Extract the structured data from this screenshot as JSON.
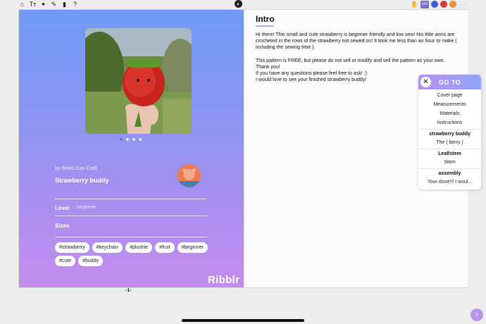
{
  "toolbar": {
    "left_icons": [
      "home-icon",
      "text-size-icon",
      "lightbulb-icon",
      "edit-icon",
      "book-icon",
      "help-icon"
    ],
    "left_glyphs": [
      "⌂",
      "Tт",
      "✦",
      "✎",
      "▮",
      "?"
    ],
    "center_glyph": "◐",
    "right": {
      "hand": "✋",
      "cm": "cm",
      "flags": [
        "#3b5bd9",
        "#d93b3b",
        "#f28c3b"
      ],
      "menu": "⋯"
    }
  },
  "pattern": {
    "author": "by Bears Can Craft",
    "title": "Strawberry buddy",
    "level_label": "Level",
    "level_value": "beginner",
    "sizes_label": "Sizes",
    "tags": [
      "#strawberry",
      "#keychain",
      "#plushie",
      "#fruit",
      "#beginner",
      "#cute",
      "#buddy"
    ],
    "brand": "Ribblr",
    "page_number": "-1-",
    "carousel_dots": 4
  },
  "intro": {
    "title": "Intro",
    "paragraph1": "Hi there! This small and cute strawberry is beginner friendly and low sew! His little arms are crocheted in the rows of the strawberry not sewed on! It took me less than an hour to make ( including the sewing time ).",
    "line2": "This pattern is FREE, but please do not sell or modify and sell the pattern as your own.",
    "line3": "Thank you!",
    "line4": "If you have any questions please feel free to ask! :)",
    "line5": "I would love to see your finished strawberry buddy!"
  },
  "goto": {
    "title": "GO TO",
    "close": "✕",
    "items1": [
      "Cover page",
      "Measurements",
      "Materials",
      "Instructions"
    ],
    "section1": "strawberry buddy",
    "items2": [
      "The ( berry )"
    ],
    "section2": "Leaf/stem",
    "items3": [
      "Stem"
    ],
    "section3": "assembly",
    "items4": [
      "Your done!!! I woul..."
    ]
  },
  "nav": {
    "next": "›"
  }
}
